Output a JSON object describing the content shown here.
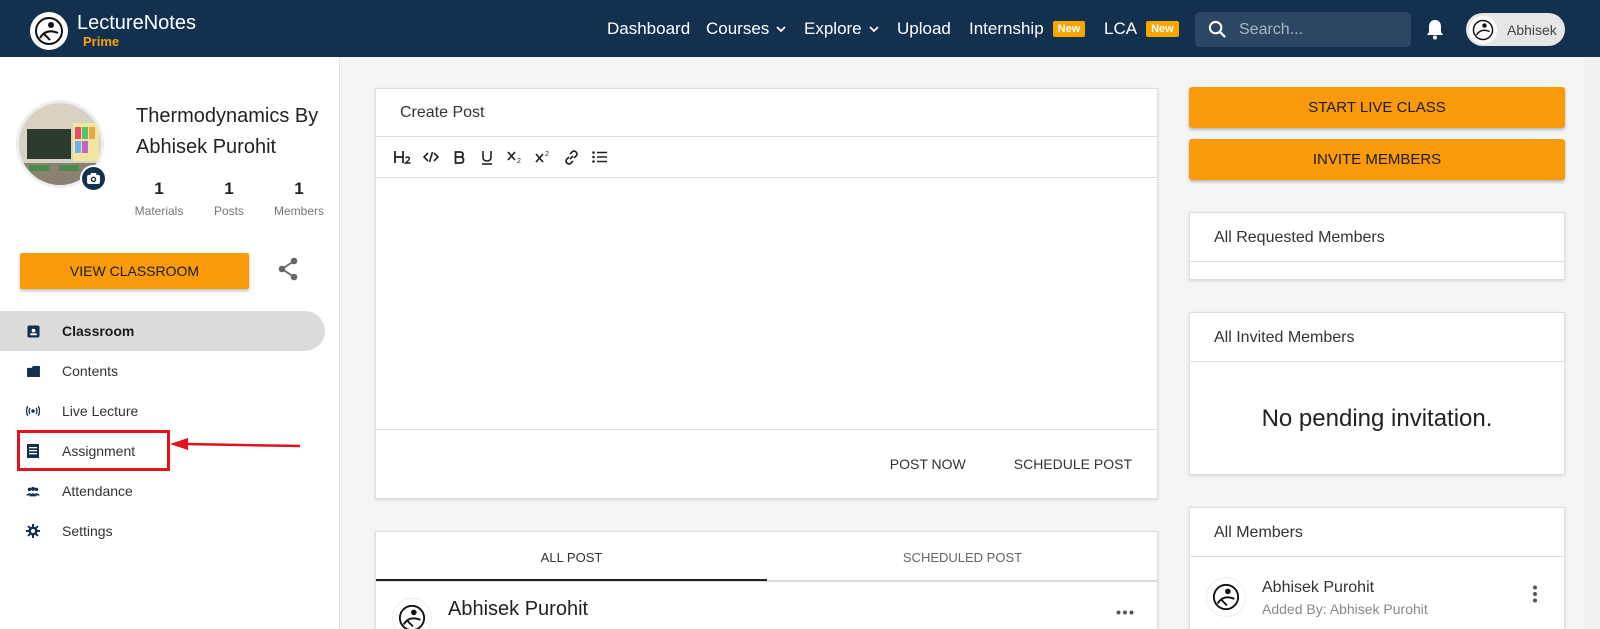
{
  "brand": {
    "name": "LectureNotes",
    "sub": "Prime"
  },
  "nav": {
    "dashboard": "Dashboard",
    "courses": "Courses",
    "explore": "Explore",
    "upload": "Upload",
    "internship": "Internship",
    "internship_badge": "New",
    "lca": "LCA",
    "lca_badge": "New"
  },
  "search": {
    "placeholder": "Search..."
  },
  "user": {
    "name": "Abhisek"
  },
  "classroom": {
    "title": "Thermodynamics By Abhisek Purohit",
    "stats": [
      {
        "num": "1",
        "label": "Materials"
      },
      {
        "num": "1",
        "label": "Posts"
      },
      {
        "num": "1",
        "label": "Members"
      }
    ],
    "view_button": "VIEW CLASSROOM"
  },
  "sidebar": {
    "items": [
      {
        "label": "Classroom",
        "icon": "classroom-icon"
      },
      {
        "label": "Contents",
        "icon": "folder-icon"
      },
      {
        "label": "Live Lecture",
        "icon": "broadcast-icon"
      },
      {
        "label": "Assignment",
        "icon": "assignment-icon"
      },
      {
        "label": "Attendance",
        "icon": "people-icon"
      },
      {
        "label": "Settings",
        "icon": "gear-icon"
      }
    ]
  },
  "create_post": {
    "title": "Create Post",
    "toolbar": [
      "H2",
      "code",
      "bold",
      "underline",
      "subscript",
      "superscript",
      "link",
      "list"
    ],
    "post_now": "POST NOW",
    "schedule": "SCHEDULE POST"
  },
  "post_tabs": {
    "all": "ALL POST",
    "scheduled": "SCHEDULED POST"
  },
  "post": {
    "author": "Abhisek Purohit"
  },
  "right": {
    "live_button": "START LIVE CLASS",
    "invite_button": "INVITE MEMBERS",
    "requested_title": "All Requested Members",
    "invited_title": "All Invited Members",
    "invited_empty": "No pending invitation.",
    "members_title": "All Members",
    "member_name": "Abhisek Purohit",
    "member_sub": "Added By: Abhisek Purohit"
  },
  "colors": {
    "navbar": "#14304f",
    "accent": "#f99a0b",
    "highlight": "#e3131b"
  }
}
